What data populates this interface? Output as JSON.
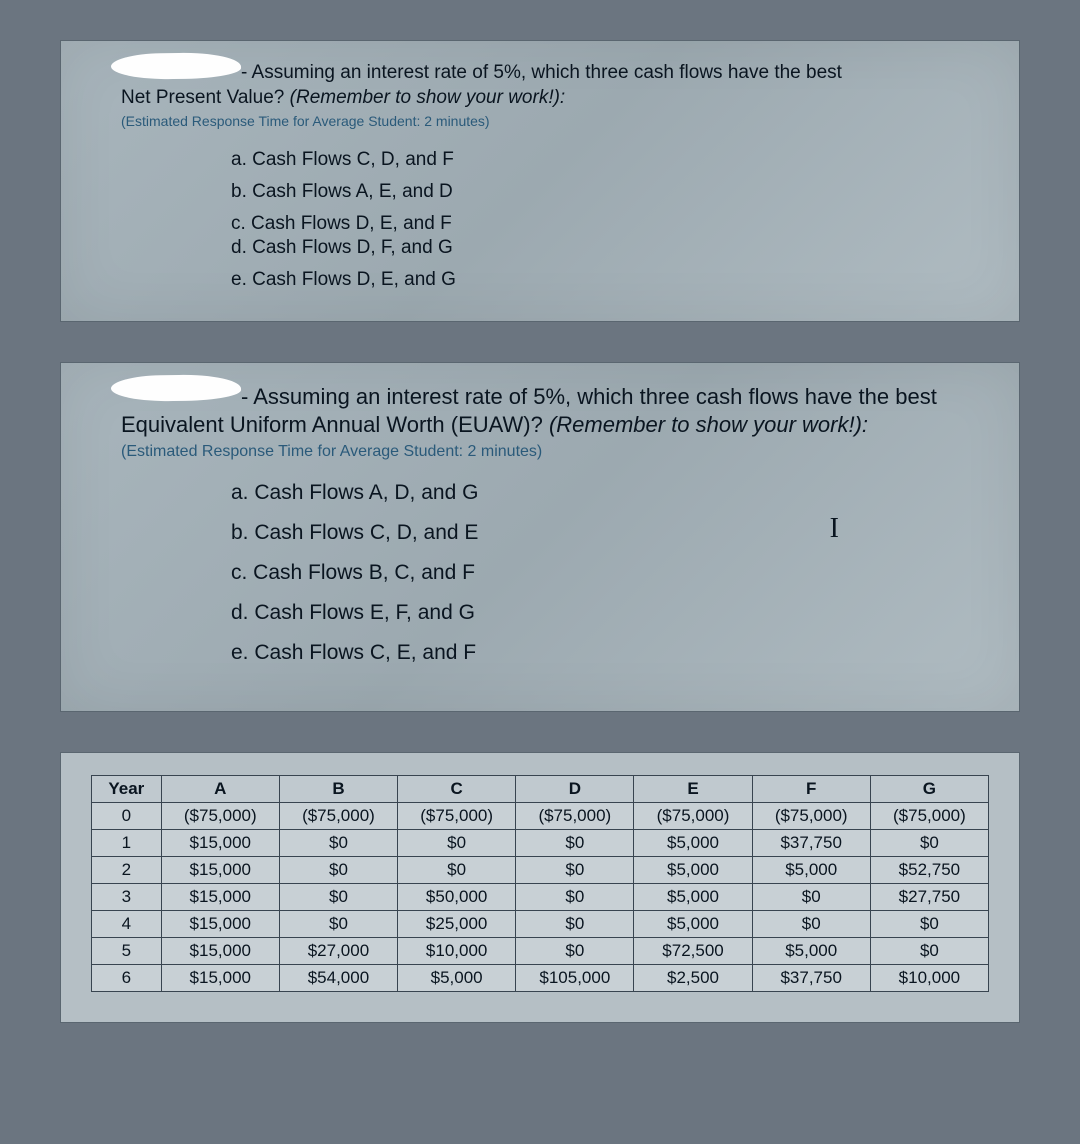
{
  "q1": {
    "lead": "- Assuming an interest rate of 5%, which three cash flows have the best",
    "line2a": "Net Present Value? ",
    "line2b": "(Remember to show your work!):",
    "estimate": "(Estimated Response Time for Average Student: 2 minutes)",
    "options": {
      "a": "a.  Cash Flows C, D, and F",
      "b": "b.  Cash Flows A, E, and D",
      "c": "c.  Cash Flows D, E, and F",
      "d": "d.  Cash Flows D, F, and G",
      "e": "e.  Cash Flows D, E, and G"
    }
  },
  "q2": {
    "lead": "- Assuming an interest rate of 5%, which three cash flows have the best",
    "line2a": "Equivalent Uniform Annual Worth (EUAW)? ",
    "line2b": "(Remember to show your work!):",
    "estimate": "(Estimated Response Time for Average Student: 2 minutes)",
    "options": {
      "a": "a.  Cash Flows A, D, and G",
      "b": "b.  Cash Flows C, D, and E",
      "c": "c.  Cash Flows B, C, and F",
      "d": "d.  Cash Flows E, F, and G",
      "e": "e.  Cash Flows C, E, and F"
    }
  },
  "table": {
    "headers": [
      "Year",
      "A",
      "B",
      "C",
      "D",
      "E",
      "F",
      "G"
    ],
    "rows": [
      [
        "0",
        "($75,000)",
        "($75,000)",
        "($75,000)",
        "($75,000)",
        "($75,000)",
        "($75,000)",
        "($75,000)"
      ],
      [
        "1",
        "$15,000",
        "$0",
        "$0",
        "$0",
        "$5,000",
        "$37,750",
        "$0"
      ],
      [
        "2",
        "$15,000",
        "$0",
        "$0",
        "$0",
        "$5,000",
        "$5,000",
        "$52,750"
      ],
      [
        "3",
        "$15,000",
        "$0",
        "$50,000",
        "$0",
        "$5,000",
        "$0",
        "$27,750"
      ],
      [
        "4",
        "$15,000",
        "$0",
        "$25,000",
        "$0",
        "$5,000",
        "$0",
        "$0"
      ],
      [
        "5",
        "$15,000",
        "$27,000",
        "$10,000",
        "$0",
        "$72,500",
        "$5,000",
        "$0"
      ],
      [
        "6",
        "$15,000",
        "$54,000",
        "$5,000",
        "$105,000",
        "$2,500",
        "$37,750",
        "$10,000"
      ]
    ]
  }
}
